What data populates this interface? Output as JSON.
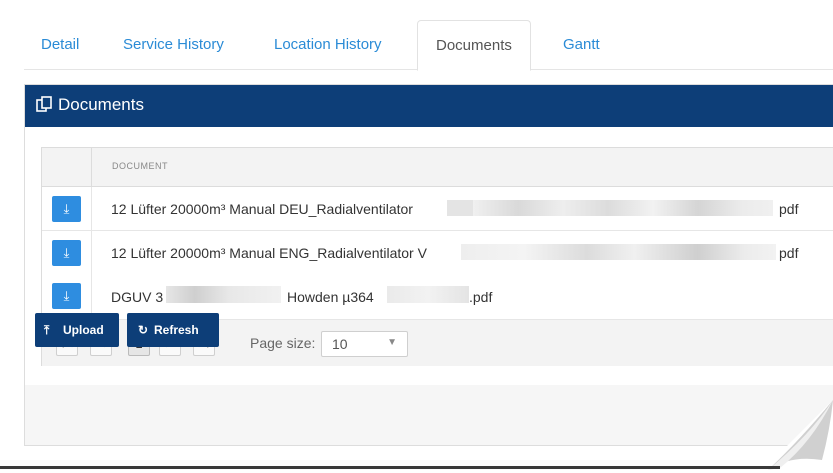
{
  "tabs": [
    "Detail",
    "Service History",
    "Location History",
    "Documents",
    "Gantt"
  ],
  "active_tab": "Documents",
  "panel": {
    "title": "Documents",
    "icon": "copy-icon"
  },
  "grid": {
    "column_header": "DOCUMENT",
    "rows": [
      {
        "name": "12 Lüfter 20000m³ Manual DEU_Radialventilator ",
        "ext": "pdf"
      },
      {
        "name": "12 Lüfter 20000m³ Manual ENG_Radialventilator V",
        "ext": "pdf"
      },
      {
        "name_part1": "DGUV 3",
        "name_part2": "Howden µ364",
        "ext": ".pdf"
      }
    ],
    "download_icon": "download-icon"
  },
  "pager": {
    "current_page": "1",
    "page_size_label": "Page size:",
    "page_size": "10"
  },
  "buttons": {
    "upload": "Upload",
    "refresh": "Refresh"
  },
  "colors": {
    "header": "#0d3e78",
    "accent": "#2e8de0",
    "tab_link": "#2a8bd6"
  }
}
